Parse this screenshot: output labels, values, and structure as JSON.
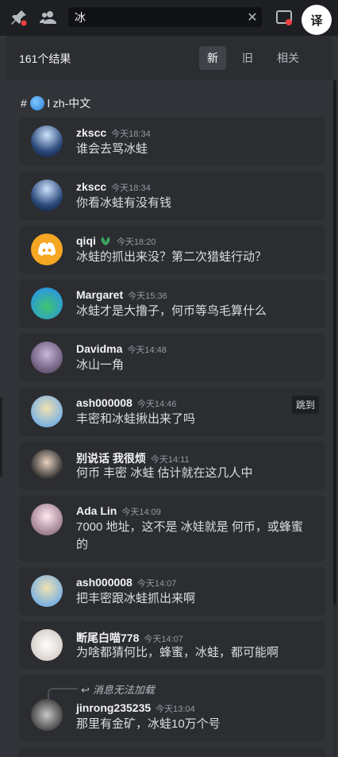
{
  "search": {
    "value": "冰"
  },
  "toolbar": {
    "translate_label": "译"
  },
  "results": {
    "count_label": "161个结果",
    "tabs": [
      {
        "label": "新",
        "active": true
      },
      {
        "label": "旧",
        "active": false
      },
      {
        "label": "相关",
        "active": false
      }
    ]
  },
  "channel": {
    "hash": "#",
    "name": "l zh-中文"
  },
  "messages": [
    {
      "author": "zkscc",
      "time": "今天18:34",
      "text": "谁会去骂冰蛙"
    },
    {
      "author": "zkscc",
      "time": "今天18:34",
      "text": "你看冰蛙有没有钱"
    },
    {
      "author": "qiqi",
      "time": "今天18:20",
      "text": "冰蛙的抓出来没？第二次猎蛙行动？"
    },
    {
      "author": "Margaret",
      "time": "今天15:36",
      "text": "冰蛙才是大撸子，何币等鸟毛算什么"
    },
    {
      "author": "Davidma",
      "time": "今天14:48",
      "text": "冰山一角"
    },
    {
      "author": "ash000008",
      "time": "今天14:46",
      "text": "丰密和冰蛙揪出来了吗",
      "jump": "跳到"
    },
    {
      "author": "别说话 我很烦",
      "time": "今天14:11",
      "text": "何币 丰密 冰蛙 估计就在这几人中"
    },
    {
      "author": "Ada Lin",
      "time": "今天14:09",
      "text": "7000 地址，这不是 冰娃就是 何币，或蜂蜜的"
    },
    {
      "author": "ash000008",
      "time": "今天14:07",
      "text": "把丰密跟冰蛙抓出来啊"
    },
    {
      "author": "断尾白喵778",
      "time": "今天14:07",
      "text": "为啥都猜何比，蜂蜜，冰蛙，都可能啊"
    },
    {
      "author": "jinrong235235",
      "time": "今天13:04",
      "text": "那里有金矿，冰蛙10万个号",
      "reply": "消息无法加载"
    }
  ],
  "colors": {
    "background": "#313338",
    "card": "#2b2d31",
    "topbar": "#1e1f22",
    "discord_blurple": "#5865f2",
    "qiqi_avatar": "#f5a623"
  }
}
